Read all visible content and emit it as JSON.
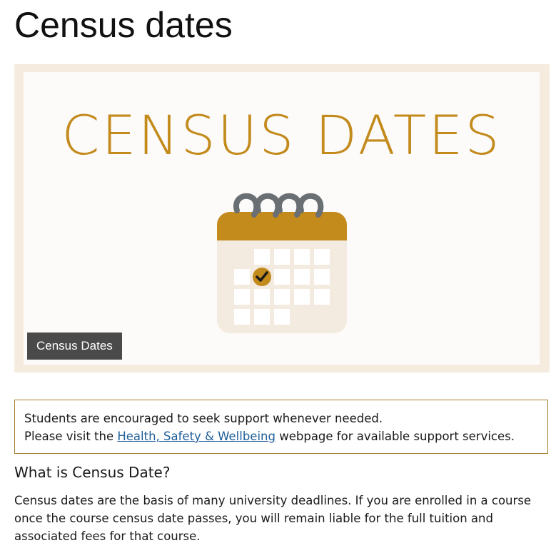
{
  "page": {
    "title": "Census dates"
  },
  "banner": {
    "heading": "CENSUS DATES",
    "caption": "Census Dates",
    "colors": {
      "frame": "#f5ecdf",
      "accent": "#c38a1c",
      "calendar_body": "#f3ebe0",
      "ring": "#6a6f73"
    },
    "icon": "calendar-checkmark-icon"
  },
  "notice": {
    "line1": "Students are encouraged to seek support whenever needed.",
    "line2_before": "Please visit the ",
    "link_text": "Health, Safety & Wellbeing",
    "line2_after": " webpage for available support services."
  },
  "section": {
    "heading": "What is Census Date?",
    "paragraph": "Census dates are the basis of many university deadlines. If you are enrolled in a course once the course census date passes, you will remain liable for the full tuition and associated fees for that course."
  }
}
